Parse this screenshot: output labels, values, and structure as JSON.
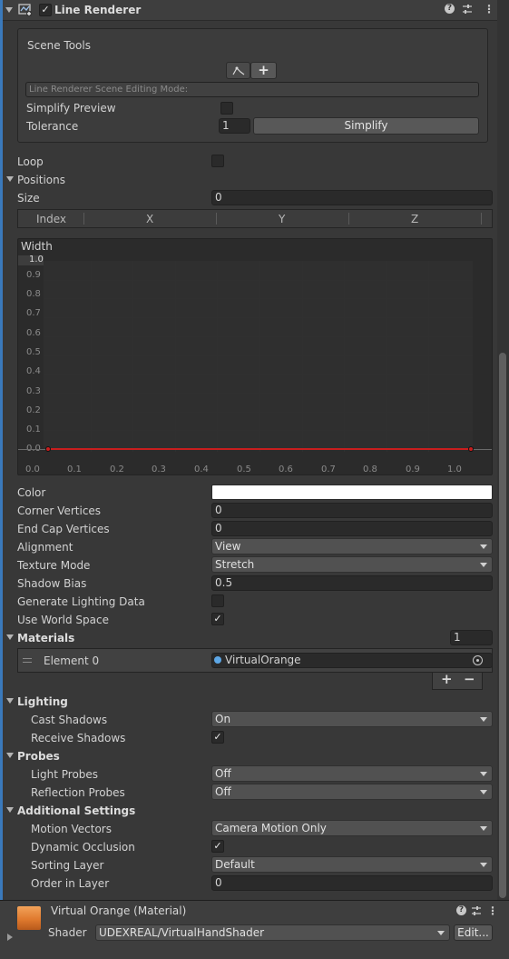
{
  "component": {
    "title": "Line Renderer",
    "enabled_checkbox": "✓"
  },
  "scene_tools": {
    "title": "Scene Tools",
    "edit_mode_placeholder": "Line Renderer Scene Editing Mode:",
    "simplify_preview_label": "Simplify Preview",
    "tolerance_label": "Tolerance",
    "tolerance_value": "1",
    "simplify_button": "Simplify"
  },
  "loop_label": "Loop",
  "positions": {
    "label": "Positions",
    "size_label": "Size",
    "size_value": "0",
    "columns": [
      "Index",
      "X",
      "Y",
      "Z"
    ]
  },
  "width_curve": {
    "label": "Width",
    "y_ticks": [
      "1.0",
      "0.9",
      "0.8",
      "0.7",
      "0.6",
      "0.5",
      "0.4",
      "0.3",
      "0.2",
      "0.1",
      "0.0"
    ],
    "x_ticks": [
      "0.0",
      "0.1",
      "0.2",
      "0.3",
      "0.4",
      "0.5",
      "0.6",
      "0.7",
      "0.8",
      "0.9",
      "1.0"
    ],
    "curve_color": "#c81e1e"
  },
  "properties": {
    "color_label": "Color",
    "color_value": "#ffffff",
    "corner_vertices_label": "Corner Vertices",
    "corner_vertices_value": "0",
    "end_cap_vertices_label": "End Cap Vertices",
    "end_cap_vertices_value": "0",
    "alignment_label": "Alignment",
    "alignment_value": "View",
    "texture_mode_label": "Texture Mode",
    "texture_mode_value": "Stretch",
    "shadow_bias_label": "Shadow Bias",
    "shadow_bias_value": "0.5",
    "generate_lighting_label": "Generate Lighting Data",
    "use_world_space_label": "Use World Space",
    "use_world_space_check": "✓"
  },
  "materials": {
    "label": "Materials",
    "count": "1",
    "element_label": "Element 0",
    "element_value": "VirtualOrange",
    "add_button": "+",
    "remove_button": "−"
  },
  "lighting": {
    "label": "Lighting",
    "cast_shadows_label": "Cast Shadows",
    "cast_shadows_value": "On",
    "receive_shadows_label": "Receive Shadows",
    "receive_shadows_check": "✓"
  },
  "probes": {
    "label": "Probes",
    "light_probes_label": "Light Probes",
    "light_probes_value": "Off",
    "reflection_probes_label": "Reflection Probes",
    "reflection_probes_value": "Off"
  },
  "additional": {
    "label": "Additional Settings",
    "motion_vectors_label": "Motion Vectors",
    "motion_vectors_value": "Camera Motion Only",
    "dynamic_occlusion_label": "Dynamic Occlusion",
    "dynamic_occlusion_check": "✓",
    "sorting_layer_label": "Sorting Layer",
    "sorting_layer_value": "Default",
    "order_in_layer_label": "Order in Layer",
    "order_in_layer_value": "0"
  },
  "material_footer": {
    "title": "Virtual Orange (Material)",
    "shader_label": "Shader",
    "shader_value": "UDEXREAL/VirtualHandShader",
    "edit_button": "Edit...",
    "swatch_color": "#e07a2e"
  },
  "colors": {
    "accent_bar": "#3a79bb",
    "background": "#383838"
  }
}
